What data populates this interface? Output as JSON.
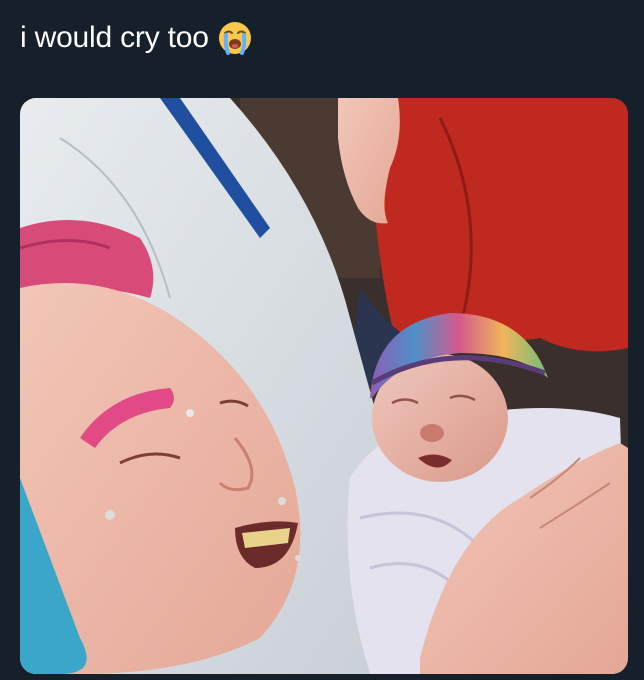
{
  "post": {
    "caption_text": "i would cry too",
    "caption_emoji": "loudly-crying-face-emoji",
    "background_color": "#15202b",
    "text_color": "#ffffff"
  },
  "photo": {
    "subject": "photo"
  }
}
